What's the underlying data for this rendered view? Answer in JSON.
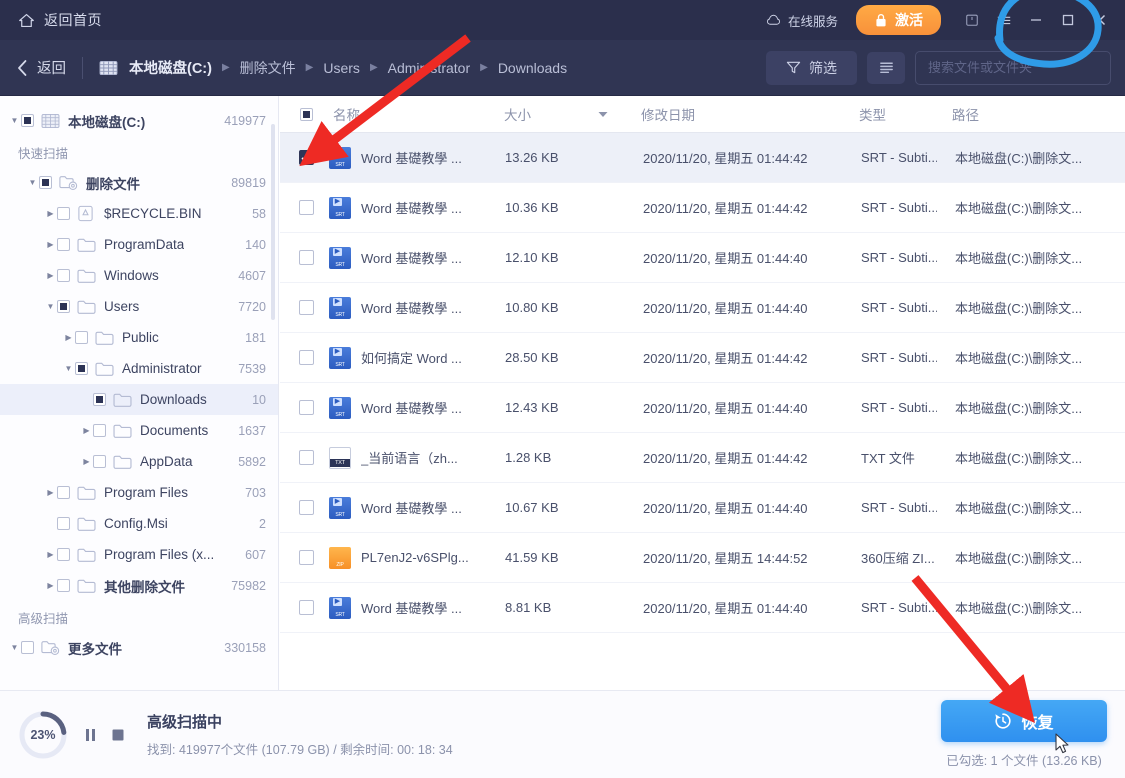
{
  "titlebar": {
    "home_label": "返回首页",
    "home_icon": "home-icon",
    "service_label": "在线服务",
    "service_icon": "cloud-icon",
    "activate_label": "激活",
    "activate_icon": "lock-icon",
    "activate_color": "#f8913a",
    "window_controls": [
      {
        "name": "feedback-icon",
        "glyph": "⎘"
      },
      {
        "name": "menu-icon",
        "glyph": "≡"
      },
      {
        "name": "minimize-icon",
        "glyph": "−"
      },
      {
        "name": "maximize-icon",
        "glyph": "▢"
      },
      {
        "name": "close-icon",
        "glyph": "✕"
      }
    ]
  },
  "navbar": {
    "back_label": "返回",
    "back_icon": "chevron-left-icon",
    "drive_icon": "drive-icon",
    "breadcrumbs": [
      "本地磁盘(C:)",
      "删除文件",
      "Users",
      "Administrator",
      "Downloads"
    ],
    "crumb_separator": "▶",
    "filter_label": "筛选",
    "filter_icon": "funnel-icon",
    "view_icon": "list-view-icon",
    "search_placeholder": "搜索文件或文件夹",
    "search_value": "",
    "search_icon": "search-icon"
  },
  "sidebar": {
    "groups": [
      {
        "title": "",
        "items": [
          {
            "label": "本地磁盘(C:)",
            "count": "419977",
            "indent": 0,
            "caret": "down",
            "check": "partial",
            "icon": "drive-icon",
            "bold": true,
            "selected": false
          }
        ]
      },
      {
        "title": "快速扫描",
        "items": [
          {
            "label": "删除文件",
            "count": "89819",
            "indent": 1,
            "caret": "down",
            "check": "partial",
            "icon": "deleted-folder-icon",
            "bold": true,
            "selected": false
          },
          {
            "label": "$RECYCLE.BIN",
            "count": "58",
            "indent": 2,
            "caret": "right",
            "check": "empty",
            "icon": "recycle-icon",
            "bold": false,
            "selected": false
          },
          {
            "label": "ProgramData",
            "count": "140",
            "indent": 2,
            "caret": "right",
            "check": "empty",
            "icon": "folder-icon",
            "bold": false,
            "selected": false
          },
          {
            "label": "Windows",
            "count": "4607",
            "indent": 2,
            "caret": "right",
            "check": "empty",
            "icon": "folder-icon",
            "bold": false,
            "selected": false
          },
          {
            "label": "Users",
            "count": "7720",
            "indent": 2,
            "caret": "down",
            "check": "partial",
            "icon": "folder-icon",
            "bold": false,
            "selected": false
          },
          {
            "label": "Public",
            "count": "181",
            "indent": 3,
            "caret": "right",
            "check": "empty",
            "icon": "folder-icon",
            "bold": false,
            "selected": false
          },
          {
            "label": "Administrator",
            "count": "7539",
            "indent": 3,
            "caret": "down",
            "check": "partial",
            "icon": "folder-icon",
            "bold": false,
            "selected": false
          },
          {
            "label": "Downloads",
            "count": "10",
            "indent": 4,
            "caret": "none",
            "check": "partial",
            "icon": "folder-icon",
            "bold": false,
            "selected": true
          },
          {
            "label": "Documents",
            "count": "1637",
            "indent": 4,
            "caret": "right",
            "check": "empty",
            "icon": "folder-icon",
            "bold": false,
            "selected": false
          },
          {
            "label": "AppData",
            "count": "5892",
            "indent": 4,
            "caret": "right",
            "check": "empty",
            "icon": "folder-icon",
            "bold": false,
            "selected": false
          },
          {
            "label": "Program Files",
            "count": "703",
            "indent": 2,
            "caret": "right",
            "check": "empty",
            "icon": "folder-icon",
            "bold": false,
            "selected": false
          },
          {
            "label": "Config.Msi",
            "count": "2",
            "indent": 2,
            "caret": "none",
            "check": "empty",
            "icon": "folder-icon",
            "bold": false,
            "selected": false
          },
          {
            "label": "Program Files (x...",
            "count": "607",
            "indent": 2,
            "caret": "right",
            "check": "empty",
            "icon": "folder-icon",
            "bold": false,
            "selected": false
          },
          {
            "label": "其他删除文件",
            "count": "75982",
            "indent": 2,
            "caret": "right",
            "check": "empty",
            "icon": "folder-icon",
            "bold": true,
            "selected": false
          }
        ]
      },
      {
        "title": "高级扫描",
        "items": [
          {
            "label": "更多文件",
            "count": "330158",
            "indent": 0,
            "caret": "down",
            "check": "empty",
            "icon": "more-files-icon",
            "bold": true,
            "selected": false
          }
        ]
      }
    ]
  },
  "table": {
    "columns": [
      {
        "key": "name",
        "label": "名称",
        "sort": false
      },
      {
        "key": "size",
        "label": "大小",
        "sort": true
      },
      {
        "key": "date",
        "label": "修改日期",
        "sort": false
      },
      {
        "key": "type",
        "label": "类型",
        "sort": false
      },
      {
        "key": "path",
        "label": "路径",
        "sort": false
      }
    ],
    "sort_icon": "caret-down-icon",
    "header_check": "partial",
    "rows": [
      {
        "checked": true,
        "icon": "srt",
        "name": "Word 基礎教學 ...",
        "size": "13.26 KB",
        "date": "2020/11/20, 星期五 01:44:42",
        "type": "SRT - Subti...",
        "path": "本地磁盘(C:)\\删除文..."
      },
      {
        "checked": false,
        "icon": "srt",
        "name": "Word 基礎教學 ...",
        "size": "10.36 KB",
        "date": "2020/11/20, 星期五 01:44:42",
        "type": "SRT - Subti...",
        "path": "本地磁盘(C:)\\删除文..."
      },
      {
        "checked": false,
        "icon": "srt",
        "name": "Word 基礎教學 ...",
        "size": "12.10 KB",
        "date": "2020/11/20, 星期五 01:44:40",
        "type": "SRT - Subti...",
        "path": "本地磁盘(C:)\\删除文..."
      },
      {
        "checked": false,
        "icon": "srt",
        "name": "Word 基礎教學 ...",
        "size": "10.80 KB",
        "date": "2020/11/20, 星期五 01:44:40",
        "type": "SRT - Subti...",
        "path": "本地磁盘(C:)\\删除文..."
      },
      {
        "checked": false,
        "icon": "srt",
        "name": "如何搞定 Word ...",
        "size": "28.50 KB",
        "date": "2020/11/20, 星期五 01:44:42",
        "type": "SRT - Subti...",
        "path": "本地磁盘(C:)\\删除文..."
      },
      {
        "checked": false,
        "icon": "srt",
        "name": "Word 基礎教學 ...",
        "size": "12.43 KB",
        "date": "2020/11/20, 星期五 01:44:40",
        "type": "SRT - Subti...",
        "path": "本地磁盘(C:)\\删除文..."
      },
      {
        "checked": false,
        "icon": "txt",
        "name": "_当前语言（zh...",
        "size": "1.28 KB",
        "date": "2020/11/20, 星期五 01:44:42",
        "type": "TXT 文件",
        "path": "本地磁盘(C:)\\删除文..."
      },
      {
        "checked": false,
        "icon": "srt",
        "name": "Word 基礎教學 ...",
        "size": "10.67 KB",
        "date": "2020/11/20, 星期五 01:44:40",
        "type": "SRT - Subti...",
        "path": "本地磁盘(C:)\\删除文..."
      },
      {
        "checked": false,
        "icon": "zip",
        "name": "PL7enJ2-v6SPlg...",
        "size": "41.59 KB",
        "date": "2020/11/20, 星期五 14:44:52",
        "type": "360压缩 ZI...",
        "path": "本地磁盘(C:)\\删除文..."
      },
      {
        "checked": false,
        "icon": "srt",
        "name": "Word 基礎教學 ...",
        "size": "8.81 KB",
        "date": "2020/11/20, 星期五 01:44:40",
        "type": "SRT - Subti...",
        "path": "本地磁盘(C:)\\删除文..."
      }
    ]
  },
  "bottom": {
    "progress_percent": "23%",
    "progress_value": 23,
    "pause_icon": "pause-icon",
    "stop_icon": "stop-icon",
    "status_title": "高级扫描中",
    "status_detail": "找到: 419977个文件 (107.79 GB) / 剩余时间:  00: 18: 34",
    "recover_label": "恢复",
    "recover_icon": "restore-icon",
    "recover_color": "#2f90ef",
    "selection_summary": "已勾选: 1 个文件 (13.26 KB)"
  },
  "annotations": {
    "arrow_color": "#ee2a24",
    "circle_color": "#2f9ce8"
  }
}
